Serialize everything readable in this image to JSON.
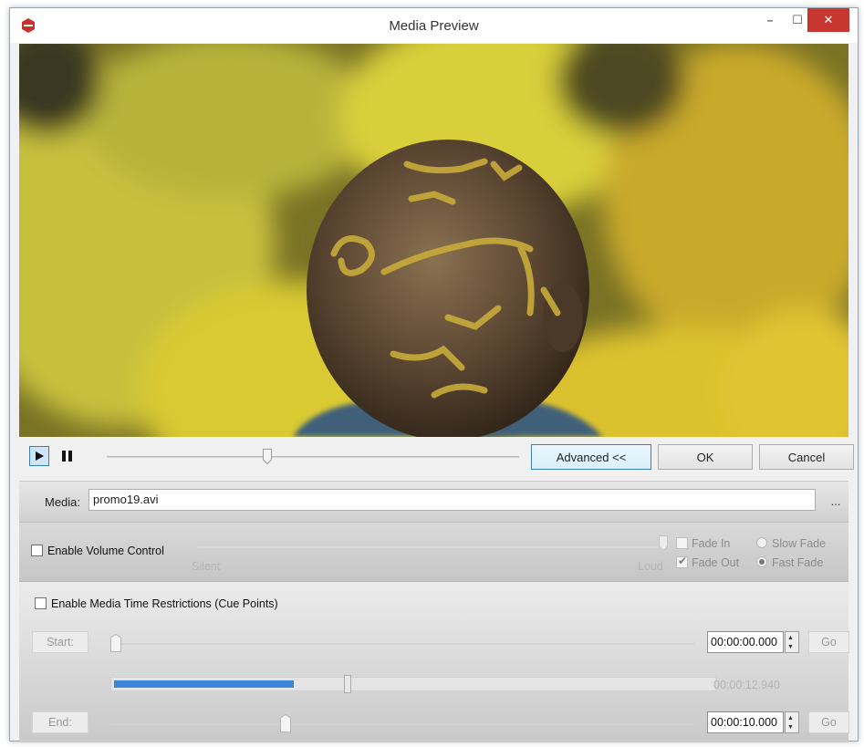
{
  "window": {
    "title": "Media Preview",
    "minimize_glyph": "–",
    "maximize_glyph": "☐",
    "close_glyph": "✕"
  },
  "playback": {
    "play_icon": "play-icon",
    "pause_icon": "pause-icon",
    "seek_position": 0.39,
    "advanced_label": "Advanced <<",
    "ok_label": "OK",
    "cancel_label": "Cancel"
  },
  "media": {
    "label": "Media:",
    "value": "promo19.avi",
    "browse_label": "..."
  },
  "volume": {
    "enable_label": "Enable Volume Control",
    "enabled": false,
    "silent_label": "Silent",
    "loud_label": "Loud",
    "level": 1.0,
    "fade_in_label": "Fade In",
    "fade_in_checked": false,
    "fade_out_label": "Fade Out",
    "fade_out_checked": true,
    "slow_fade_label": "Slow Fade",
    "fast_fade_label": "Fast Fade",
    "fade_speed": "Fast Fade"
  },
  "cue_points": {
    "enable_label": "Enable Media Time Restrictions (Cue Points)",
    "enabled": false,
    "start_label": "Start:",
    "start_time": "00:00:00.000",
    "start_position": 0.0,
    "end_label": "End:",
    "end_time": "00:00:10.000",
    "end_position": 0.3,
    "go_label": "Go",
    "duration": "00:00:12.940",
    "progress_fraction": 0.3
  },
  "colors": {
    "accent_blue": "#3c86d8",
    "close_red": "#c7362f",
    "focus_border": "#3c7fb1"
  }
}
